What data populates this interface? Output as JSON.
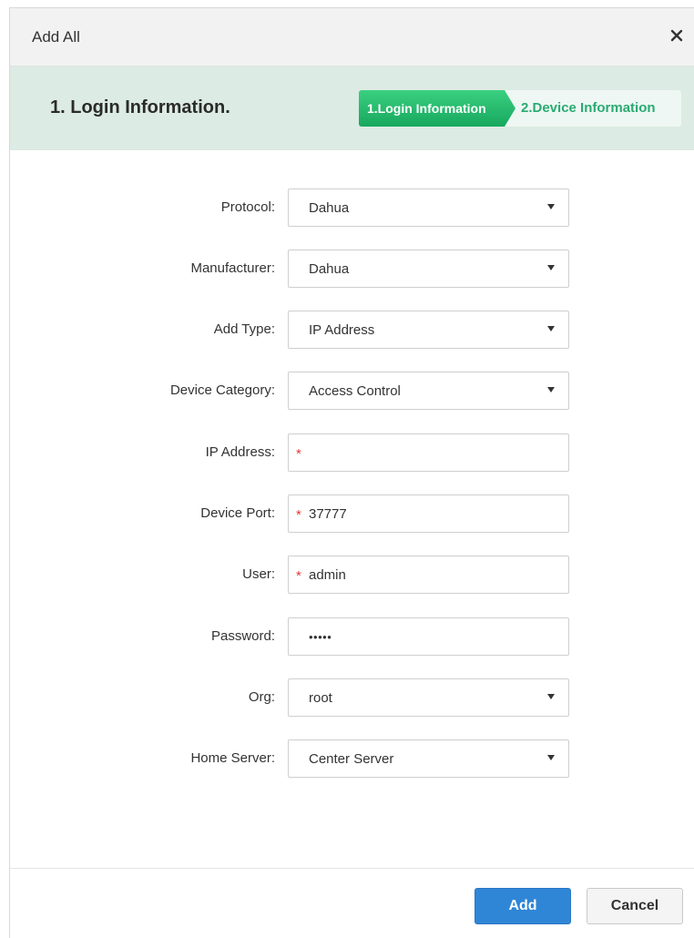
{
  "dialog": {
    "title": "Add All",
    "close_icon": "close-icon"
  },
  "banner": {
    "heading": "1.  Login Information.",
    "steps": [
      {
        "label": "1.Login Information",
        "active": true
      },
      {
        "label": "2.Device Information",
        "active": false
      }
    ]
  },
  "form": {
    "protocol": {
      "label": "Protocol:",
      "value": "Dahua"
    },
    "manufacturer": {
      "label": "Manufacturer:",
      "value": "Dahua"
    },
    "add_type": {
      "label": "Add Type:",
      "value": "IP Address"
    },
    "device_category": {
      "label": "Device Category:",
      "value": "Access Control"
    },
    "ip_address": {
      "label": "IP Address:",
      "value": "",
      "required_mark": "*"
    },
    "device_port": {
      "label": "Device Port:",
      "value": "37777",
      "required_mark": "*"
    },
    "user": {
      "label": "User:",
      "value": "admin",
      "required_mark": "*"
    },
    "password": {
      "label": "Password:",
      "value": "•••••"
    },
    "org": {
      "label": "Org:",
      "value": "root"
    },
    "home_server": {
      "label": "Home Server:",
      "value": "Center Server"
    }
  },
  "footer": {
    "add_label": "Add",
    "cancel_label": "Cancel"
  },
  "colors": {
    "primary": "#2f86d6",
    "step_active": "#1fb266",
    "banner_bg": "#dcebe3",
    "required": "#e53935"
  }
}
